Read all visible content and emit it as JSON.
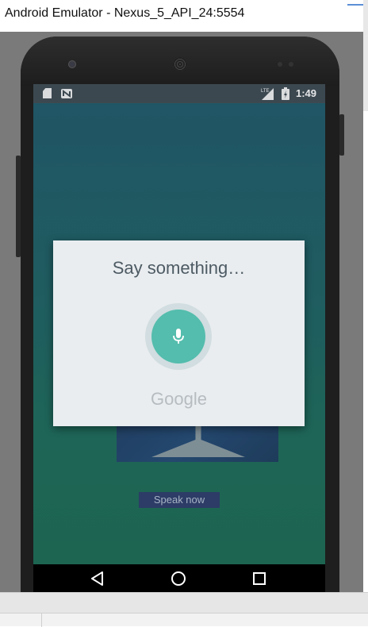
{
  "window": {
    "title": "Android Emulator - Nexus_5_API_24:5554"
  },
  "statusbar": {
    "icons": [
      "sd-card-icon",
      "nfc-icon",
      "lte-signal-icon",
      "battery-icon"
    ],
    "time": "1:49"
  },
  "dialog": {
    "prompt": "Say something…",
    "mic_icon": "microphone-icon",
    "brand": "Google",
    "accent_color": "#54bdad"
  },
  "app": {
    "speak_button_label": "Speak now"
  },
  "navbar": {
    "icons": [
      "back-icon",
      "home-icon",
      "recents-icon"
    ]
  }
}
